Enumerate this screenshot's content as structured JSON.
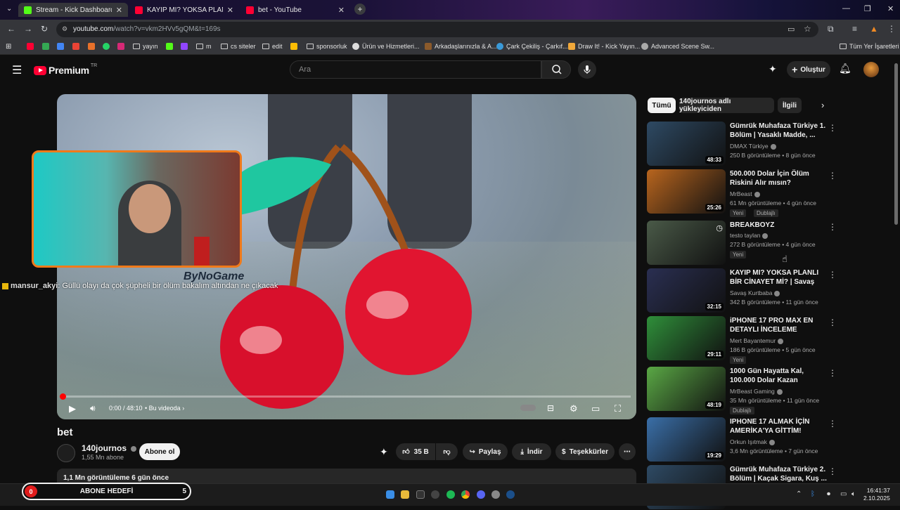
{
  "browser": {
    "tabs": [
      {
        "title": "Stream - Kick Dashboard -",
        "favicon_color": "#53fc18",
        "active": true
      },
      {
        "title": "KAYIP MI? YOKSA PLANLI BİR C",
        "favicon_color": "#ff0033",
        "active": false
      },
      {
        "title": "bet - YouTube",
        "favicon_color": "#ff0033",
        "active": false
      }
    ],
    "url_host": "youtube.com",
    "url_path": "/watch?v=vkm2HVv5gQM&t=169s",
    "bookmarks": [
      "yayın",
      "m",
      "cs siteler",
      "edit",
      "sponsorluk",
      "Ürün ve Hizmetleri...",
      "Arkadaşlarınızla & A...",
      "Çark Çekiliş - Çarkıf...",
      "Draw It! - Kick Yayın...",
      "Advanced Scene Sw..."
    ],
    "bookmarks_right": "Tüm Yer İşaretleri"
  },
  "youtube": {
    "logo_text": "Premium",
    "logo_suffix": "TR",
    "search_placeholder": "Ara",
    "create_label": "Oluştur"
  },
  "player": {
    "time": "0:00 / 48:10",
    "chapter": "Bu videoda",
    "watermark": "ByNoGame",
    "progress": 0.0
  },
  "chat_overlay": {
    "user": "mansur_akyi",
    "message": ": Güllü olayı da çok şüpheli bir ölüm bakalım altından ne çıkacak"
  },
  "video": {
    "title": "bet",
    "channel": "140journos",
    "subscribers": "1,55 Mn abone",
    "subscribe_label": "Abone ol",
    "likes": "35 B",
    "share_label": "Paylaş",
    "download_label": "İndir",
    "thanks_label": "Teşekkürler",
    "views_date": "1,1 Mn görüntüleme  6 gün önce"
  },
  "chips": [
    "Tümü",
    "140journos adlı yükleyiciden",
    "İlgili"
  ],
  "recommendations": [
    {
      "title": "Gümrük Muhafaza Türkiye 1. Bölüm | Yasaklı Madde, ...",
      "channel": "DMAX Türkiye",
      "meta": "250 B görüntüleme • 8 gün önce",
      "duration": "48:33",
      "badges": [],
      "thumb": "#2e4a64"
    },
    {
      "title": "500.000 Dolar İçin Ölüm Riskini Alır mısın?",
      "channel": "MrBeast",
      "meta": "61 Mn görüntüleme • 4 gün önce",
      "duration": "25:26",
      "badges": [
        "Yeni",
        "Dublajlı"
      ],
      "thumb": "#b8651e"
    },
    {
      "title": "BREAKBOYZ",
      "channel": "testo taylan",
      "meta": "272 B görüntüleme • 4 gün önce",
      "duration": "",
      "badges": [
        "Yeni"
      ],
      "thumb": "#4a5a48"
    },
    {
      "title": "KAYIP MI? YOKSA PLANLI BİR CİNAYET Mİ? | Savaş Kurtbaba...",
      "channel": "Savaş Kurtbaba",
      "meta": "342 B görüntüleme • 11 gün önce",
      "duration": "32:15",
      "badges": [],
      "thumb": "#2a2f52"
    },
    {
      "title": "iPHONE 17 PRO MAX EN DETAYLI İNCELEME",
      "channel": "Mert Bayantemur",
      "meta": "186 B görüntüleme • 5 gün önce",
      "duration": "29:11",
      "badges": [
        "Yeni"
      ],
      "thumb": "#2f8f3a"
    },
    {
      "title": "1000 Gün Hayatta Kal, 100.000 Dolar Kazan",
      "channel": "MrBeast Gaming",
      "meta": "35 Mn görüntüleme • 11 gün önce",
      "duration": "48:19",
      "badges": [
        "Dublajlı"
      ],
      "thumb": "#5aa845"
    },
    {
      "title": "IPHONE 17 ALMAK İÇİN AMERİKA'YA GİTTİM!",
      "channel": "Orkun Işıtmak",
      "meta": "3,6 Mn görüntüleme • 7 gün önce",
      "duration": "19:29",
      "badges": [],
      "thumb": "#3a6fa8"
    },
    {
      "title": "Gümrük Muhafaza Türkiye 2. Bölüm | Kaçak Sigara, Kuş ...",
      "channel": "",
      "meta": "",
      "duration": "",
      "badges": [],
      "thumb": "#2e4a64"
    }
  ],
  "goal": {
    "current": "0",
    "label": "ABONE HEDEFİ",
    "target": "5"
  },
  "clock": {
    "time": "16:41:37",
    "date": "2.10.2025"
  }
}
